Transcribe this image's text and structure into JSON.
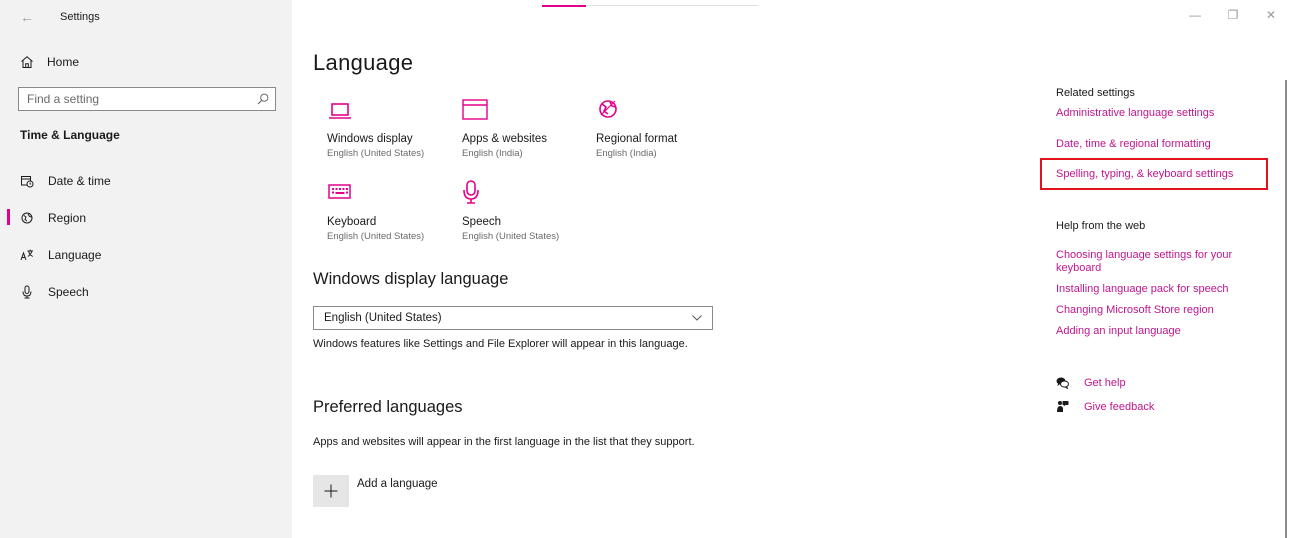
{
  "window": {
    "title": "Settings",
    "controls": [
      "—",
      "❐",
      "✕"
    ]
  },
  "sidebar": {
    "home_label": "Home",
    "search_placeholder": "Find a setting",
    "section_title": "Time & Language",
    "items": [
      {
        "label": "Date & time",
        "icon": "calendar-clock-icon",
        "selected": false
      },
      {
        "label": "Region",
        "icon": "globe-icon",
        "selected": true
      },
      {
        "label": "Language",
        "icon": "language-icon",
        "selected": false
      },
      {
        "label": "Speech",
        "icon": "microphone-icon",
        "selected": false
      }
    ]
  },
  "main": {
    "title": "Language",
    "tiles": [
      {
        "name": "Windows display",
        "value": "English (United States)",
        "icon": "laptop-icon"
      },
      {
        "name": "Apps & websites",
        "value": "English (India)",
        "icon": "window-icon"
      },
      {
        "name": "Regional format",
        "value": "English (India)",
        "icon": "globe-icon"
      },
      {
        "name": "Keyboard",
        "value": "English (United States)",
        "icon": "keyboard-icon"
      },
      {
        "name": "Speech",
        "value": "English (United States)",
        "icon": "microphone-icon"
      }
    ],
    "display_language": {
      "heading": "Windows display language",
      "selected": "English (United States)",
      "description": "Windows features like Settings and File Explorer will appear in this language."
    },
    "preferred": {
      "heading": "Preferred languages",
      "description": "Apps and websites will appear in the first language in the list that they support.",
      "add_label": "Add a language"
    }
  },
  "related": {
    "heading": "Related settings",
    "links": [
      "Administrative language settings",
      "Date, time & regional formatting",
      "Spelling, typing, & keyboard settings"
    ],
    "help_heading": "Help from the web",
    "help_links": [
      "Choosing language settings for your keyboard",
      "Installing language pack for speech",
      "Changing Microsoft Store region",
      "Adding an input language"
    ],
    "get_help": "Get help",
    "give_feedback": "Give feedback"
  },
  "colors": {
    "accent": "#e3008c",
    "link": "#c0168e",
    "highlight": "#e0121b",
    "sidebar_bg": "#f2f2f2"
  }
}
